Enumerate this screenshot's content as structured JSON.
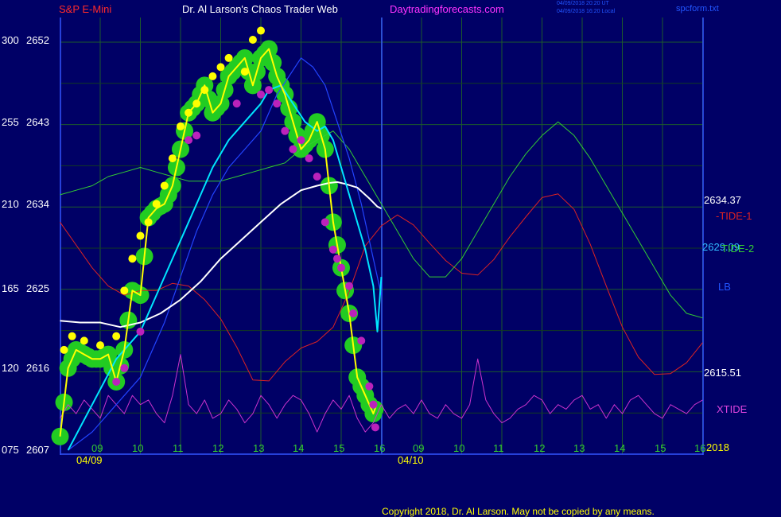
{
  "header": {
    "symbol": "S&P E-Mini",
    "title": "Dr. Al Larson's Chaos Trader Web",
    "site": "Daytradingforecasts.com",
    "timestamp_1": "04/09/2018 20:20 UT",
    "timestamp_2": "04/09/2018 16:20 Local",
    "file": "spcform.txt"
  },
  "footer": {
    "copyright": "Copyright 2018, Dr. Al Larson. May not be copied by any means."
  },
  "colors": {
    "background": "#000066",
    "price": "#ffff00",
    "ma_fast": "#00e5ff",
    "ma_mid": "#2244ff",
    "ma_slow": "#ffffff",
    "tide1": "#dd2222",
    "tide2": "#33cc33",
    "xtide": "#cc33cc",
    "up_bubble": "#22cc22",
    "pivot_high": "#ffff00",
    "pivot_low": "#bb22bb"
  },
  "chart_data": {
    "type": "line",
    "y_left_labels": [
      "300",
      "255",
      "210",
      "165",
      "120",
      "075"
    ],
    "y_price_labels": [
      "2652",
      "2643",
      "2634",
      "2625",
      "2616",
      "2607"
    ],
    "ylim": [
      2607,
      2652
    ],
    "hour_labels": [
      "09",
      "10",
      "11",
      "12",
      "13",
      "14",
      "15",
      "16",
      "09",
      "10",
      "11",
      "12",
      "13",
      "14",
      "15",
      "16"
    ],
    "date_labels": [
      "04/09",
      "04/10"
    ],
    "year_label": "2018",
    "right_values": {
      "tide1_value": "2634.37",
      "tide2_value": "2629.09",
      "last_value": "2615.51"
    },
    "series_labels": {
      "tide1": "-TIDE-1",
      "tide2": "TIDE-2",
      "lb": "LB",
      "xtide": "XTIDE"
    },
    "series": [
      {
        "name": "Price",
        "color": "#ffff00",
        "x": [
          0,
          0.2,
          0.4,
          0.6,
          0.8,
          1.0,
          1.2,
          1.4,
          1.6,
          1.8,
          2.0,
          2.2,
          2.4,
          2.6,
          2.8,
          3.0,
          3.2,
          3.4,
          3.6,
          3.8,
          4.0,
          4.2,
          4.4,
          4.6,
          4.8,
          5.0,
          5.2,
          5.4,
          5.6,
          5.8,
          6.0,
          6.2,
          6.4,
          6.6,
          6.8,
          7.0,
          7.2,
          7.4,
          7.6,
          7.8,
          7.88
        ],
        "y": [
          2608.5,
          2616,
          2618,
          2617.5,
          2617,
          2617,
          2617.5,
          2614.5,
          2618,
          2624.5,
          2624,
          2632.5,
          2633.5,
          2634,
          2636,
          2640,
          2644,
          2645,
          2647,
          2644,
          2645,
          2648,
          2649,
          2650,
          2647,
          2650,
          2651,
          2648,
          2646,
          2643,
          2640,
          2641,
          2643,
          2640,
          2632,
          2627,
          2622,
          2615,
          2613,
          2611,
          2612
        ]
      },
      {
        "name": "MA fast",
        "color": "#00e5ff",
        "x": [
          0.2,
          0.8,
          1.4,
          2.0,
          2.6,
          3.0,
          3.4,
          3.8,
          4.2,
          4.6,
          5.0,
          5.2,
          5.5,
          5.8,
          6.1,
          6.4,
          6.6,
          6.8,
          7.0,
          7.2,
          7.4,
          7.6,
          7.8,
          7.9,
          8.0
        ],
        "y": [
          2607,
          2612,
          2617,
          2620,
          2626,
          2630,
          2634,
          2638,
          2641,
          2643,
          2645,
          2646.5,
          2647,
          2645,
          2643,
          2642,
          2642.5,
          2641,
          2638,
          2635,
          2632,
          2629,
          2625,
          2620,
          2626
        ]
      },
      {
        "name": "MA mid",
        "color": "#2244ff",
        "x": [
          0.2,
          0.8,
          1.4,
          2.0,
          2.6,
          3.0,
          3.4,
          3.8,
          4.2,
          4.6,
          5.0,
          5.4,
          5.7,
          6.0,
          6.3,
          6.6,
          6.9,
          7.2,
          7.5,
          7.8,
          8.0
        ],
        "y": [
          2607,
          2609,
          2612,
          2615,
          2621,
          2626,
          2631,
          2635,
          2638,
          2640,
          2642,
          2646,
          2648,
          2650,
          2649,
          2647,
          2643,
          2639,
          2634,
          2628,
          2624
        ]
      },
      {
        "name": "MA slow",
        "color": "#ffffff",
        "x": [
          0,
          0.5,
          1.0,
          1.5,
          2.0,
          2.5,
          3.0,
          3.5,
          4.0,
          4.5,
          5.0,
          5.5,
          6.0,
          6.4,
          6.7,
          6.9,
          7.1,
          7.4,
          7.7,
          7.9,
          8.0
        ],
        "y": [
          2621.2,
          2621,
          2621,
          2620.5,
          2621,
          2622,
          2623.5,
          2625.5,
          2628,
          2630,
          2632,
          2634,
          2635.5,
          2636,
          2636.3,
          2636.4,
          2636.2,
          2635.8,
          2634.6,
          2633.7,
          2633.5
        ]
      },
      {
        "name": "-TIDE-1",
        "color": "#dd2222",
        "x": [
          0,
          0.4,
          0.8,
          1.2,
          1.6,
          2.0,
          2.4,
          2.8,
          3.2,
          3.6,
          4.0,
          4.4,
          4.8,
          5.2,
          5.6,
          6.0,
          6.4,
          6.8,
          7.2,
          7.6,
          8.0,
          8.4,
          8.8,
          9.2,
          9.6,
          10.0,
          10.4,
          10.8,
          11.2,
          11.6,
          12.0,
          12.4,
          12.8,
          13.2,
          13.6,
          14.0,
          14.4,
          14.8,
          15.2,
          15.6,
          16.0
        ],
        "y": [
          2632,
          2629.5,
          2627,
          2625,
          2624,
          2624.5,
          2624.5,
          2625.3,
          2625,
          2623.5,
          2621.4,
          2618.3,
          2614.7,
          2614.6,
          2616.7,
          2618.2,
          2618.9,
          2620.5,
          2624.4,
          2629.4,
          2631.6,
          2632.8,
          2631.7,
          2629.7,
          2627.8,
          2626.4,
          2626.2,
          2627.9,
          2630.4,
          2632.6,
          2634.7,
          2635.1,
          2633.4,
          2629.6,
          2625,
          2620.5,
          2617.2,
          2615.3,
          2615.4,
          2616.6,
          2618.8
        ]
      },
      {
        "name": "TIDE-2",
        "color": "#33cc33",
        "x": [
          0,
          0.4,
          0.8,
          1.2,
          1.6,
          2.0,
          2.4,
          2.8,
          3.2,
          3.6,
          4.0,
          4.4,
          4.8,
          5.2,
          5.6,
          6.0,
          6.4,
          6.8,
          7.2,
          7.6,
          8.0,
          8.4,
          8.8,
          9.2,
          9.6,
          10.0,
          10.4,
          10.8,
          11.2,
          11.6,
          12.0,
          12.4,
          12.8,
          13.2,
          13.6,
          14.0,
          14.4,
          14.8,
          15.2,
          15.6,
          16.0
        ],
        "y": [
          2635,
          2635.5,
          2636,
          2637,
          2637.5,
          2638,
          2637.5,
          2637,
          2636.5,
          2636.5,
          2636.5,
          2637,
          2637.5,
          2638,
          2638.5,
          2640,
          2641,
          2642,
          2640,
          2637,
          2634,
          2631,
          2628,
          2626,
          2626,
          2628,
          2631,
          2634,
          2637,
          2639.5,
          2641.5,
          2643,
          2641.5,
          2639,
          2636,
          2633,
          2630,
          2627,
          2624,
          2622,
          2621.5
        ]
      },
      {
        "name": "XTIDE",
        "color": "#cc33cc",
        "x": [
          0,
          0.2,
          0.4,
          0.6,
          0.8,
          1.0,
          1.2,
          1.4,
          1.6,
          1.8,
          2.0,
          2.2,
          2.4,
          2.6,
          2.8,
          3.0,
          3.2,
          3.4,
          3.6,
          3.8,
          4.0,
          4.2,
          4.4,
          4.6,
          4.8,
          5.0,
          5.2,
          5.4,
          5.6,
          5.8,
          6.0,
          6.2,
          6.4,
          6.6,
          6.8,
          7.0,
          7.2,
          7.4,
          7.6,
          7.8,
          8.0,
          8.2,
          8.4,
          8.6,
          8.8,
          9.0,
          9.2,
          9.4,
          9.6,
          9.8,
          10.0,
          10.2,
          10.4,
          10.6,
          10.8,
          11.0,
          11.2,
          11.4,
          11.6,
          11.8,
          12.0,
          12.2,
          12.4,
          12.6,
          12.8,
          13.0,
          13.2,
          13.4,
          13.6,
          13.8,
          14.0,
          14.2,
          14.4,
          14.6,
          14.8,
          15.0,
          15.2,
          15.4,
          15.6,
          15.8,
          16.0
        ],
        "y": [
          2610.5,
          2612,
          2611,
          2612.5,
          2611.5,
          2610.5,
          2613,
          2612,
          2611,
          2613,
          2612,
          2612.5,
          2611,
          2610,
          2613,
          2617.5,
          2612,
          2611,
          2612.5,
          2610.5,
          2611,
          2612.5,
          2611.5,
          2610,
          2611,
          2613,
          2612,
          2610.5,
          2612,
          2613,
          2612.5,
          2611,
          2609,
          2611,
          2612.5,
          2611.5,
          2613,
          2610.5,
          2609,
          2610,
          2612,
          2610.5,
          2611.5,
          2612,
          2611,
          2612.5,
          2611,
          2610.5,
          2612,
          2611,
          2610.5,
          2612,
          2617,
          2612.5,
          2611,
          2610,
          2610.5,
          2611.5,
          2612,
          2613,
          2612.5,
          2611,
          2612,
          2611.5,
          2612.5,
          2613,
          2611.5,
          2612,
          2610.5,
          2612,
          2611,
          2612.5,
          2613,
          2612,
          2611,
          2610.5,
          2612,
          2611.5,
          2611,
          2612,
          2612.5
        ]
      }
    ],
    "pivot_highs": {
      "x": [
        0.1,
        0.3,
        0.6,
        1.0,
        1.4,
        1.6,
        1.8,
        2.0,
        2.2,
        2.4,
        2.6,
        2.8,
        3.0,
        3.2,
        3.4,
        3.6,
        3.8,
        4.0,
        4.2,
        4.6,
        4.8,
        5.0
      ],
      "y": [
        2618,
        2619.5,
        2619,
        2618.5,
        2619.5,
        2624.5,
        2628,
        2630.5,
        2632,
        2634,
        2636,
        2639,
        2642.5,
        2644,
        2645,
        2646.5,
        2648,
        2649,
        2650,
        2648.5,
        2652,
        2653
      ]
    },
    "pivot_lows": {
      "x": [
        1.4,
        1.6,
        2.0,
        3.2,
        3.4,
        4.4,
        5.0,
        5.2,
        5.4,
        5.6,
        5.8,
        6.0,
        6.2,
        6.4,
        6.6,
        6.8,
        6.9,
        7.0,
        7.2,
        7.3,
        7.5,
        7.7,
        7.8,
        7.85
      ],
      "y": [
        2614.5,
        2616,
        2620,
        2641,
        2641.5,
        2645,
        2646,
        2646.5,
        2645,
        2642,
        2640,
        2641,
        2639,
        2637,
        2632,
        2629,
        2628,
        2627,
        2625,
        2622,
        2619,
        2614,
        2612,
        2609.5
      ]
    }
  }
}
